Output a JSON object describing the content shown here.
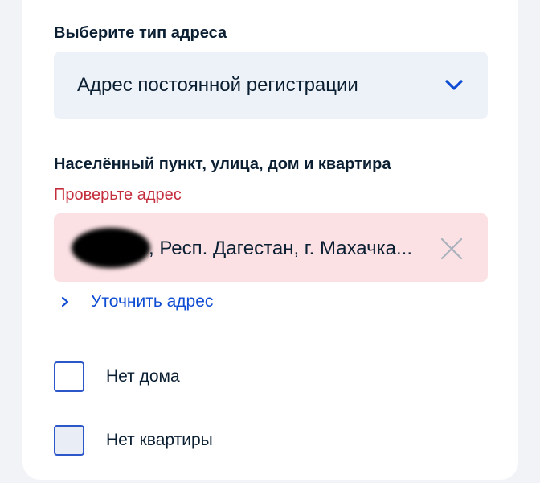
{
  "address_type": {
    "label": "Выберите тип адреса",
    "selected": "Адрес постоянной регистрации",
    "dropdown_icon": "chevron-down-icon"
  },
  "address": {
    "label": "Населённый пункт, улица, дом и квартира",
    "error": "Проверьте адрес",
    "value": ", Респ. Дагестан, г. Махачка...",
    "clear_icon": "close-icon"
  },
  "refine_link": {
    "label": "Уточнить адрес",
    "icon": "chevron-right-icon"
  },
  "checkboxes": [
    {
      "label": "Нет дома",
      "checked": false
    },
    {
      "label": "Нет квартиры",
      "checked": false
    }
  ],
  "colors": {
    "error": "#c42d3c",
    "accent": "#0d4cd3",
    "error_field_bg": "#fbe1e4",
    "select_bg": "#edf2f8"
  }
}
